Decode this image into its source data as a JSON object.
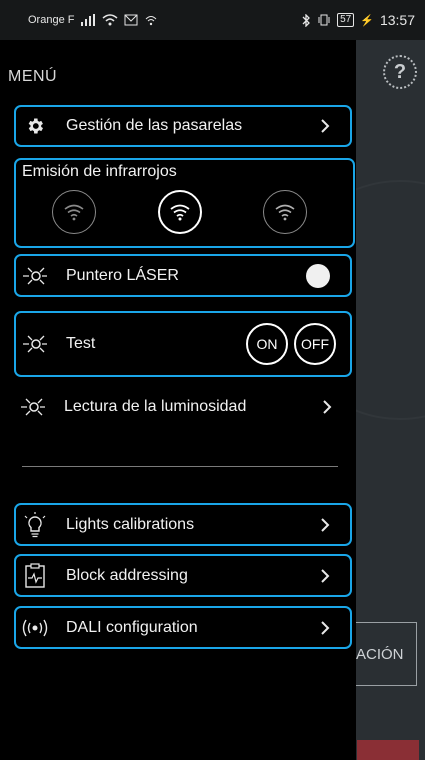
{
  "status_bar": {
    "carrier": "Orange F",
    "battery": "57",
    "time": "13:57"
  },
  "drawer": {
    "title": "MENÚ",
    "gateways": {
      "label": "Gestión de las pasarelas",
      "icon": "gear-icon"
    },
    "infrared": {
      "title": "Emisión de infrarrojos"
    },
    "laser": {
      "label": "Puntero LÁSER",
      "icon": "light-icon"
    },
    "test": {
      "label": "Test",
      "on": "ON",
      "off": "OFF",
      "icon": "light-icon"
    },
    "luminosity": {
      "label": "Lectura de la luminosidad",
      "icon": "light-icon"
    },
    "lights": {
      "label": "Lights calibrations",
      "icon": "bulb-icon"
    },
    "block": {
      "label": "Block addressing",
      "icon": "clipboard-icon"
    },
    "dali": {
      "label": "DALI configuration",
      "icon": "signal-icon"
    }
  },
  "background": {
    "help": "?",
    "button_text": "ACIÓN"
  },
  "colors": {
    "accent": "#1aa6e8",
    "drawer": "#000000"
  }
}
